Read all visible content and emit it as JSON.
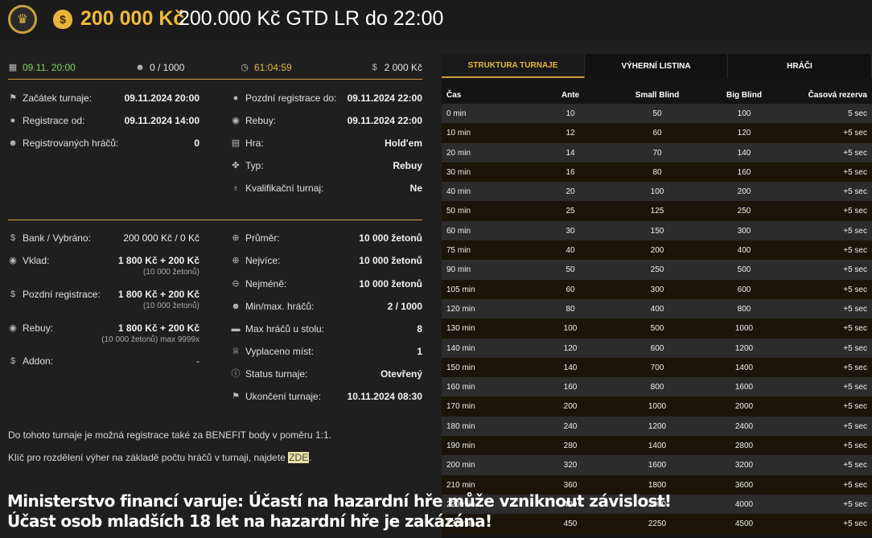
{
  "header": {
    "amount": "200 000 Kč",
    "name": "200.000 Kč GTD LR do 22:00"
  },
  "topstats": {
    "date": "09.11. 20:00",
    "players": "0 / 1000",
    "timer": "61:04:59",
    "prize": "2 000 Kč"
  },
  "info_left": [
    {
      "label": "Začátek turnaje:",
      "value": "09.11.2024 20:00"
    },
    {
      "label": "Registrace od:",
      "value": "09.11.2024 14:00"
    },
    {
      "label": "Registrovaných hráčů:",
      "value": "0"
    }
  ],
  "info_right": [
    {
      "label": "Pozdní registrace do:",
      "value": "09.11.2024 22:00"
    },
    {
      "label": "Rebuy:",
      "value": "09.11.2024 22:00"
    },
    {
      "label": "Hra:",
      "value": "Hold'em"
    },
    {
      "label": "Typ:",
      "value": "Rebuy"
    },
    {
      "label": "Kvalifikační turnaj:",
      "value": "Ne"
    }
  ],
  "money_left": [
    {
      "label": "Bank / Vybráno:",
      "value": "200 000 Kč / 0 Kč",
      "sub": ""
    },
    {
      "label": "Vklad:",
      "value": "1 800 Kč + 200 Kč",
      "sub": "(10 000 žetonů)"
    },
    {
      "label": "Pozdní registrace:",
      "value": "1 800 Kč + 200 Kč",
      "sub": "(10 000 žetonů)"
    },
    {
      "label": "Rebuy:",
      "value": "1 800 Kč + 200 Kč",
      "sub": "(10 000 žetonů) max 9999x"
    },
    {
      "label": "Addon:",
      "value": "-",
      "sub": ""
    }
  ],
  "money_right": [
    {
      "label": "Průměr:",
      "value": "10 000 žetonů"
    },
    {
      "label": "Nejvíce:",
      "value": "10 000 žetonů"
    },
    {
      "label": "Nejméně:",
      "value": "10 000 žetonů"
    },
    {
      "label": "Min/max. hráčů:",
      "value": "2 / 1000"
    },
    {
      "label": "Max hráčů u stolu:",
      "value": "8"
    },
    {
      "label": "Vyplaceno míst:",
      "value": "1"
    },
    {
      "label": "Status turnaje:",
      "value": "Otevřený"
    },
    {
      "label": "Ukončení turnaje:",
      "value": "10.11.2024 08:30"
    }
  ],
  "notes": {
    "benefit": "Do tohoto turnaje je možná registrace také za BENEFIT body v poměru 1:1.",
    "key_text": "Klíč pro rozdělení výher na základě počtu hráčů v turnaji, najdete ",
    "key_link": "ZDE",
    "key_end": "."
  },
  "warning": {
    "line1": "Ministerstvo financí varuje: Účastí na hazardní hře může vzniknout závislost!",
    "line2": "Účast osob mladších 18 let na hazardní hře je zakázána!"
  },
  "tabs": [
    "STRUKTURA TURNAJE",
    "VÝHERNÍ LISTINA",
    "HRÁČI"
  ],
  "table": {
    "headers": [
      "Čas",
      "Ante",
      "Small Blind",
      "Big Blind",
      "Časová rezerva"
    ],
    "rows": [
      [
        "0 min",
        "10",
        "50",
        "100",
        "5 sec"
      ],
      [
        "10 min",
        "12",
        "60",
        "120",
        "+5 sec"
      ],
      [
        "20 min",
        "14",
        "70",
        "140",
        "+5 sec"
      ],
      [
        "30 min",
        "16",
        "80",
        "160",
        "+5 sec"
      ],
      [
        "40 min",
        "20",
        "100",
        "200",
        "+5 sec"
      ],
      [
        "50 min",
        "25",
        "125",
        "250",
        "+5 sec"
      ],
      [
        "60 min",
        "30",
        "150",
        "300",
        "+5 sec"
      ],
      [
        "75 min",
        "40",
        "200",
        "400",
        "+5 sec"
      ],
      [
        "90 min",
        "50",
        "250",
        "500",
        "+5 sec"
      ],
      [
        "105 min",
        "60",
        "300",
        "600",
        "+5 sec"
      ],
      [
        "120 min",
        "80",
        "400",
        "800",
        "+5 sec"
      ],
      [
        "130 min",
        "100",
        "500",
        "1000",
        "+5 sec"
      ],
      [
        "140 min",
        "120",
        "600",
        "1200",
        "+5 sec"
      ],
      [
        "150 min",
        "140",
        "700",
        "1400",
        "+5 sec"
      ],
      [
        "160 min",
        "160",
        "800",
        "1600",
        "+5 sec"
      ],
      [
        "170 min",
        "200",
        "1000",
        "2000",
        "+5 sec"
      ],
      [
        "180 min",
        "240",
        "1200",
        "2400",
        "+5 sec"
      ],
      [
        "190 min",
        "280",
        "1400",
        "2800",
        "+5 sec"
      ],
      [
        "200 min",
        "320",
        "1600",
        "3200",
        "+5 sec"
      ],
      [
        "210 min",
        "360",
        "1800",
        "3600",
        "+5 sec"
      ],
      [
        "220 min",
        "400",
        "2000",
        "4000",
        "+5 sec"
      ],
      [
        "230 min",
        "450",
        "2250",
        "4500",
        "+5 sec"
      ]
    ]
  }
}
